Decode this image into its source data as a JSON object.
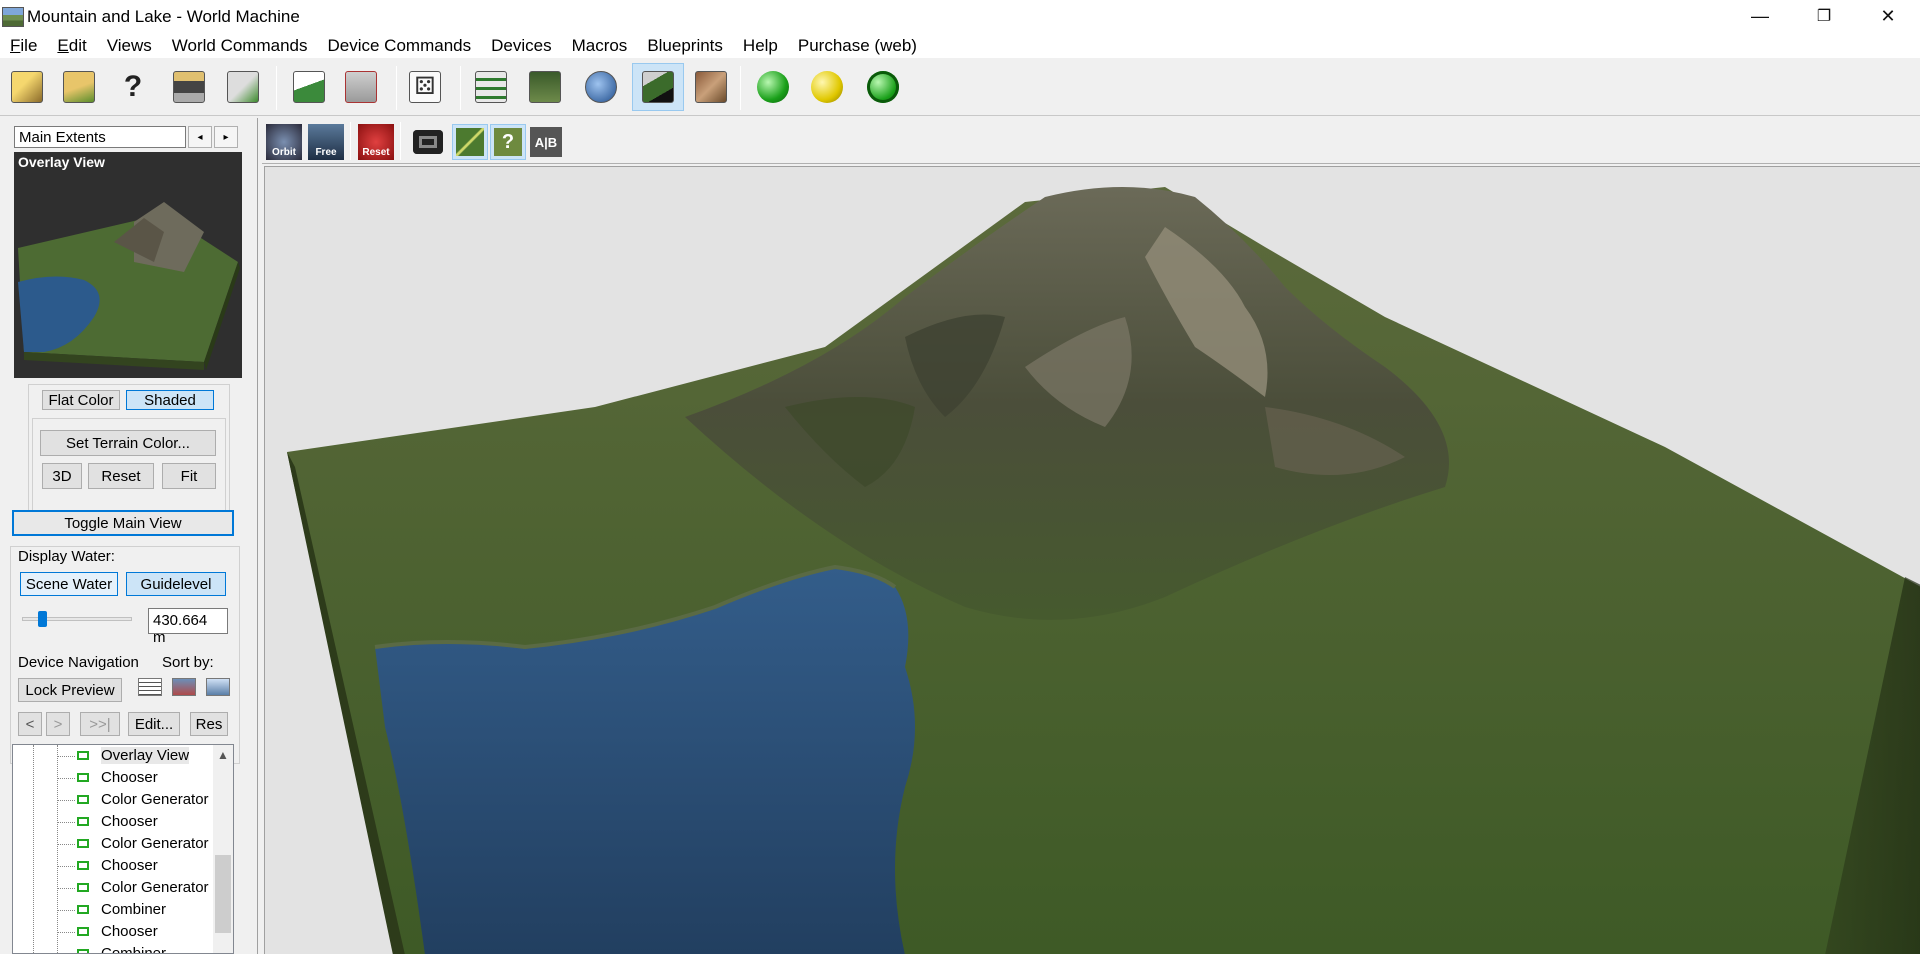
{
  "window": {
    "title": "Mountain and Lake - World Machine",
    "minimize": "—",
    "restore": "❐",
    "close": "✕"
  },
  "menu": [
    {
      "label": "File",
      "key": "F",
      "rest": "ile"
    },
    {
      "label": "Edit",
      "key": "E",
      "rest": "dit"
    },
    {
      "label": "Views"
    },
    {
      "label": "World Commands"
    },
    {
      "label": "Device Commands"
    },
    {
      "label": "Devices"
    },
    {
      "label": "Macros"
    },
    {
      "label": "Blueprints"
    },
    {
      "label": "Help"
    },
    {
      "label": "Purchase (web)"
    }
  ],
  "toolbar": {
    "icons": [
      "new-world-icon",
      "open-icon",
      "help-icon",
      "save-icon",
      "export-icon",
      "terrain-icon",
      "checklist-icon",
      "dice-icon",
      "device-view-icon",
      "layout-view-icon",
      "world-view-icon",
      "3d-view-icon",
      "texture-view-icon",
      "build-green-icon",
      "build-yellow-icon",
      "build-target-icon"
    ]
  },
  "left": {
    "extents_value": "Main Extents",
    "spin_left": "◂",
    "spin_right": "▸",
    "overlay_label": "Overlay View",
    "flat_color": "Flat Color",
    "shaded": "Shaded",
    "set_terrain_color": "Set Terrain Color...",
    "btn_3d": "3D",
    "btn_reset": "Reset",
    "btn_fit": "Fit",
    "toggle_main_view": "Toggle Main View",
    "display_water": "Display Water:",
    "scene_water": "Scene Water",
    "guidelevel": "Guidelevel",
    "water_level": "430.664 m",
    "water_slider_fraction": 0.15,
    "device_navigation": "Device Navigation",
    "sort_by": "Sort by:",
    "lock_preview": "Lock Preview",
    "nav_back": "<",
    "nav_forward": ">",
    "nav_end": ">>|",
    "edit": "Edit...",
    "res": "Res",
    "tree_items": [
      "Overlay View",
      "Chooser",
      "Color Generator",
      "Chooser",
      "Color Generator",
      "Chooser",
      "Color Generator",
      "Combiner",
      "Chooser",
      "Combiner"
    ],
    "scroll_up": "▲"
  },
  "viewport_toolbar": {
    "orbit": "Orbit",
    "free": "Free",
    "reset": "Reset",
    "ab": "A|B"
  },
  "colors": {
    "accent": "#0078d7",
    "selected_bg": "#cce4f7",
    "terrain_green": "#4f6a33",
    "water_blue": "#2c4f76",
    "rock": "#7a7666"
  }
}
